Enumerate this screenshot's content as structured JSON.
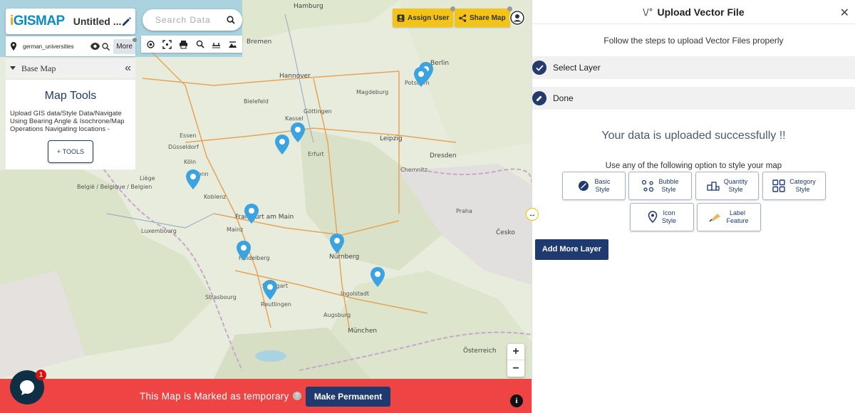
{
  "brand": {
    "logo_prefix": "i",
    "logo_rest": "GISMAP",
    "map_title": "Untitled ..."
  },
  "layer": {
    "name": "german_universities",
    "more_label": "More"
  },
  "basemap": {
    "label": "Base Map"
  },
  "tools": {
    "title": "Map Tools",
    "description": "Upload GIS data/Style Data/Navigate Using Bearing Angle & Isochrone/Map Operations Navigating locations -",
    "button": "+ TOOLS"
  },
  "search": {
    "placeholder": "Search Data"
  },
  "actions": {
    "assign_user": "Assign User",
    "share_map": "Share Map"
  },
  "zoom": {
    "in": "+",
    "out": "−"
  },
  "temp_bar": {
    "message": "This Map is Marked as temporary",
    "button": "Make Permanent",
    "info": "i"
  },
  "chat": {
    "badge": "1"
  },
  "map_labels": [
    "Hamburg",
    "Bremen",
    "Hannover",
    "Berlin",
    "Potsdam",
    "Magdeburg",
    "Leipzig",
    "Dresden",
    "Essen",
    "Düsseldorf",
    "Köln",
    "Bonn",
    "Erfurt",
    "Chemnitz",
    "Frankfurt am Main",
    "Mainz",
    "Praha",
    "Nürnberg",
    "Heidelberg",
    "Stuttgart",
    "Strasbourg",
    "Luxembourg",
    "Reutlingen",
    "Augsburg",
    "München",
    "Ingolstadt",
    "België / Belgique / Belgien",
    "Česko",
    "Österreich",
    "Liège",
    "Koblenz",
    "Kassel",
    "Göttingen",
    "Bielefeld"
  ],
  "panel": {
    "title": "Upload Vector File",
    "subtitle": "Follow the steps to upload Vector Files properly",
    "step1": "Select Layer",
    "step2": "Done",
    "success": "Your data is uploaded successfully !!",
    "style_hint": "Use any of the following option to style your map",
    "styles": {
      "basic": [
        "Basic",
        "Style"
      ],
      "bubble": [
        "Bubble",
        "Style"
      ],
      "quantity": [
        "Quantity",
        "Style"
      ],
      "category": [
        "Category",
        "Style"
      ],
      "icon": [
        "Icon",
        "Style"
      ],
      "label": [
        "Label",
        "Feature"
      ]
    },
    "add_more": "Add More Layer"
  },
  "colors": {
    "accent_navy": "#1e3a6e",
    "yellow": "#f3c31a",
    "temp_red": "#ef4444",
    "marker_blue": "#3ba3e0"
  }
}
